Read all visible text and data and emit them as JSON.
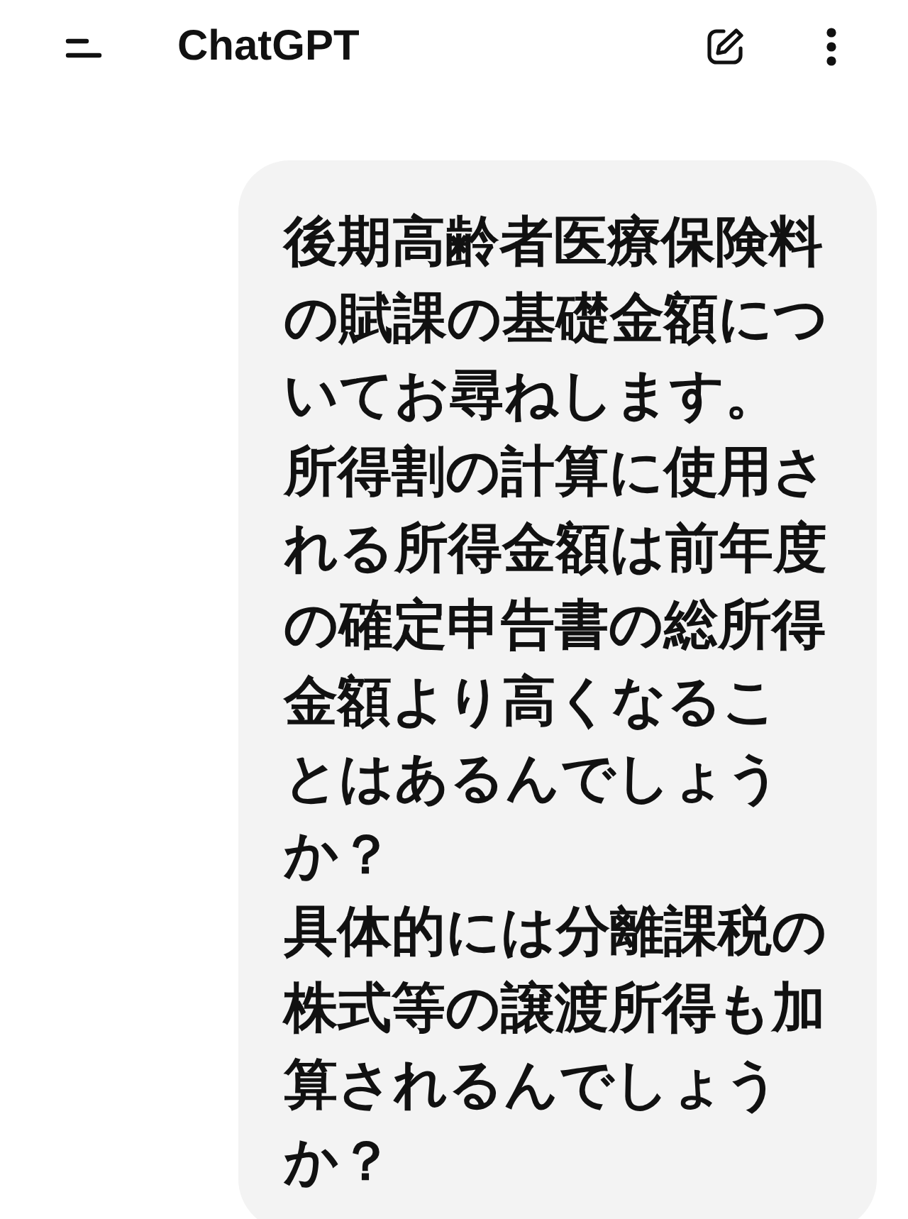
{
  "header": {
    "title": "ChatGPT"
  },
  "message": {
    "paragraphs": [
      "後期高齢者医療保険料の賦課の基礎金額についてお尋ねします。",
      "所得割の計算に使用される所得金額は前年度の確定申告書の総所得金額より高くなることはあるんでしょうか？",
      "具体的には分離課税の株式等の譲渡所得も加算されるんでしょうか？"
    ]
  }
}
